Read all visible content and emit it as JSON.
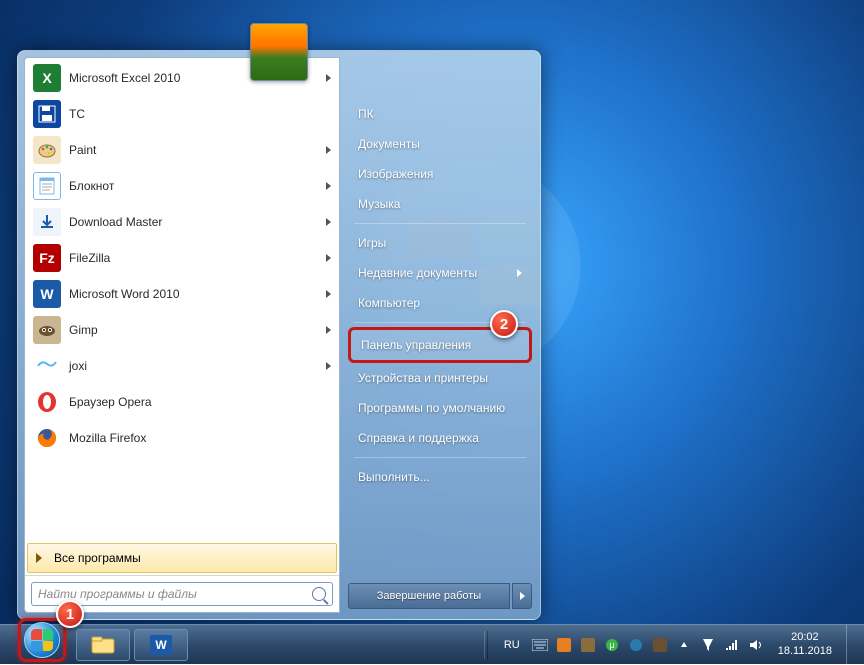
{
  "callouts": {
    "one": "1",
    "two": "2"
  },
  "programs": [
    {
      "label": "Microsoft Excel 2010",
      "icon": "excel",
      "bg": "#1e7e34",
      "has_sub": true
    },
    {
      "label": "TC",
      "icon": "floppy",
      "bg": "#0d47a1",
      "has_sub": false
    },
    {
      "label": "Paint",
      "icon": "paint",
      "bg": "#f5e6c8",
      "has_sub": true
    },
    {
      "label": "Блокнот",
      "icon": "notepad",
      "bg": "#7cb9e8",
      "has_sub": true
    },
    {
      "label": "Download Master",
      "icon": "dm",
      "bg": "#a6c8e8",
      "has_sub": true
    },
    {
      "label": "FileZilla",
      "icon": "filezilla",
      "bg": "#b30000",
      "has_sub": true
    },
    {
      "label": "Microsoft Word 2010",
      "icon": "word",
      "bg": "#1b5aa6",
      "has_sub": true
    },
    {
      "label": "Gimp",
      "icon": "gimp",
      "bg": "#6b4f2e",
      "has_sub": true
    },
    {
      "label": "joxi",
      "icon": "joxi",
      "bg": "#5bb7f0",
      "has_sub": true
    },
    {
      "label": "Браузер Opera",
      "icon": "opera",
      "bg": "#e3342f",
      "has_sub": false
    },
    {
      "label": "Mozilla Firefox",
      "icon": "firefox",
      "bg": "#ff7b00",
      "has_sub": false
    }
  ],
  "all_programs": "Все программы",
  "search_placeholder": "Найти программы и файлы",
  "right_menu": {
    "user": "ПК",
    "documents": "Документы",
    "pictures": "Изображения",
    "music": "Музыка",
    "games": "Игры",
    "recent": "Недавние документы",
    "computer": "Компьютер",
    "control_panel": "Панель управления",
    "devices": "Устройства и принтеры",
    "defaults": "Программы по умолчанию",
    "help": "Справка и поддержка",
    "run": "Выполнить..."
  },
  "shutdown": "Завершение работы",
  "tray": {
    "lang": "RU"
  },
  "clock": {
    "time": "20:02",
    "date": "18.11.2018"
  }
}
